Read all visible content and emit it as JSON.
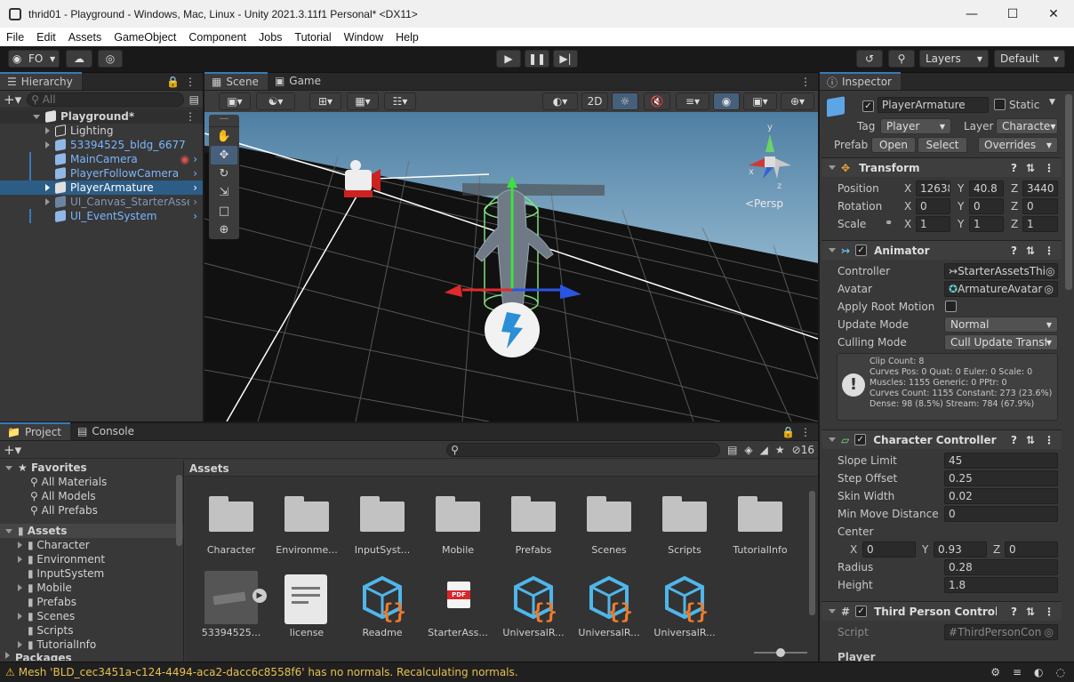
{
  "window": {
    "title": "thrid01 - Playground - Windows, Mac, Linux - Unity 2021.3.11f1 Personal* <DX11>"
  },
  "menu": [
    "File",
    "Edit",
    "Assets",
    "GameObject",
    "Component",
    "Jobs",
    "Tutorial",
    "Window",
    "Help"
  ],
  "toolbar": {
    "account": "FO",
    "layers": "Layers",
    "layout": "Default"
  },
  "hierarchy": {
    "tab": "Hierarchy",
    "search_placeholder": "All",
    "scene": "Playground*",
    "items": [
      {
        "label": "Lighting"
      },
      {
        "label": "53394525_bldg_6677"
      },
      {
        "label": "MainCamera"
      },
      {
        "label": "PlayerFollowCamera"
      },
      {
        "label": "PlayerArmature"
      },
      {
        "label": "UI_Canvas_StarterAssets"
      },
      {
        "label": "UI_EventSystem"
      }
    ]
  },
  "scene": {
    "tabs": [
      "Scene",
      "Game"
    ],
    "mode2d": "2D",
    "persp": "<Persp"
  },
  "project": {
    "tabs": [
      "Project",
      "Console"
    ],
    "count": "16",
    "breadcrumb": "Assets",
    "favorites": "Favorites",
    "favorite_items": [
      "All Materials",
      "All Models",
      "All Prefabs"
    ],
    "assets_root": "Assets",
    "tree": [
      "Character",
      "Environment",
      "InputSystem",
      "Mobile",
      "Prefabs",
      "Scenes",
      "Scripts",
      "TutorialInfo"
    ],
    "tree_cut": "Packages",
    "folders": [
      "Character",
      "Environme...",
      "InputSyst...",
      "Mobile",
      "Prefabs",
      "Scenes",
      "Scripts",
      "TutorialInfo"
    ],
    "files": [
      "53394525...",
      "license",
      "Readme",
      "StarterAss...",
      "UniversalR...",
      "UniversalR...",
      "UniversalR..."
    ],
    "pdf_text": "PDF",
    "slider": 0.5
  },
  "inspector": {
    "tab": "Inspector",
    "name": "PlayerArmature",
    "static": "Static",
    "tag_label": "Tag",
    "tag": "Player",
    "layer_label": "Layer",
    "layer": "Characte",
    "prefab_label": "Prefab",
    "open": "Open",
    "select": "Select",
    "overrides": "Overrides",
    "transform": {
      "title": "Transform",
      "position": {
        "label": "Position",
        "x": "12638",
        "y": "40.8",
        "z": "3440"
      },
      "rotation": {
        "label": "Rotation",
        "x": "0",
        "y": "0",
        "z": "0"
      },
      "scale": {
        "label": "Scale",
        "x": "1",
        "y": "1",
        "z": "1"
      }
    },
    "animator": {
      "title": "Animator",
      "controller_label": "Controller",
      "controller": "StarterAssetsThi",
      "avatar_label": "Avatar",
      "avatar": "ArmatureAvatar",
      "root_motion_label": "Apply Root Motion",
      "update_label": "Update Mode",
      "update": "Normal",
      "culling_label": "Culling Mode",
      "culling": "Cull Update Transfo",
      "info": [
        "Clip Count: 8",
        "Curves Pos: 0 Quat: 0 Euler: 0 Scale: 0",
        "Muscles: 1155 Generic: 0 PPtr: 0",
        "Curves Count: 1155 Constant: 273 (23.6%)",
        "Dense: 98 (8.5%) Stream: 784 (67.9%)"
      ]
    },
    "cc": {
      "title": "Character Controller",
      "slope_label": "Slope Limit",
      "slope": "45",
      "step_label": "Step Offset",
      "step": "0.25",
      "skin_label": "Skin Width",
      "skin": "0.02",
      "minmove_label": "Min Move Distance",
      "minmove": "0",
      "center_label": "Center",
      "cx": "0",
      "cy": "0.93",
      "cz": "0",
      "radius_label": "Radius",
      "radius": "0.28",
      "height_label": "Height",
      "height": "1.8"
    },
    "tpc": {
      "title": "Third Person Controller (S",
      "script_label": "Script",
      "script": "ThirdPersonCon",
      "player": "Player"
    },
    "axis": {
      "x": "X",
      "y": "Y",
      "z": "Z"
    }
  },
  "status": {
    "message": "Mesh 'BLD_cec3451a-c124-4494-aca2-dacc6c8558f6' has no normals. Recalculating normals."
  }
}
